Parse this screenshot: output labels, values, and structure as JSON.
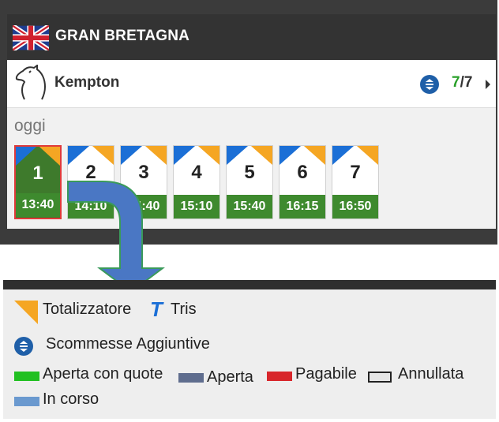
{
  "country": {
    "name": "GRAN BRETAGNA",
    "flag_icon": "uk-flag-icon"
  },
  "track": {
    "name": "Kempton",
    "race_count_open": "7",
    "race_count_total": "/7",
    "icons": [
      "horse-head-icon",
      "extra-bets-icon",
      "chevron-right-icon"
    ]
  },
  "day_label": "oggi",
  "races": [
    {
      "number": "1",
      "time": "13:40",
      "selected": true
    },
    {
      "number": "2",
      "time": "14:10"
    },
    {
      "number": "3",
      "time": "14:40"
    },
    {
      "number": "4",
      "time": "15:10"
    },
    {
      "number": "5",
      "time": "15:40"
    },
    {
      "number": "6",
      "time": "16:15"
    },
    {
      "number": "7",
      "time": "16:50"
    }
  ],
  "legend": {
    "totalizzatore": "Totalizzatore",
    "tris": "Tris",
    "tris_icon_letter": "T",
    "scommesse_aggiuntive": "Scommesse Aggiuntive",
    "aperta_con_quote": "Aperta con quote",
    "aperta": "Aperta",
    "pagabile": "Pagabile",
    "annullata": "Annullata",
    "in_corso": "In corso"
  },
  "colors": {
    "open_with_odds": "#22c022",
    "open": "#5f6d8e",
    "payable": "#d8262b",
    "cancelled": "#e6e6e6",
    "in_progress": "#6a99cf",
    "totalizzatore": "#f5a623",
    "tris": "#1b6fd6",
    "arrow": "#4a77c4"
  }
}
